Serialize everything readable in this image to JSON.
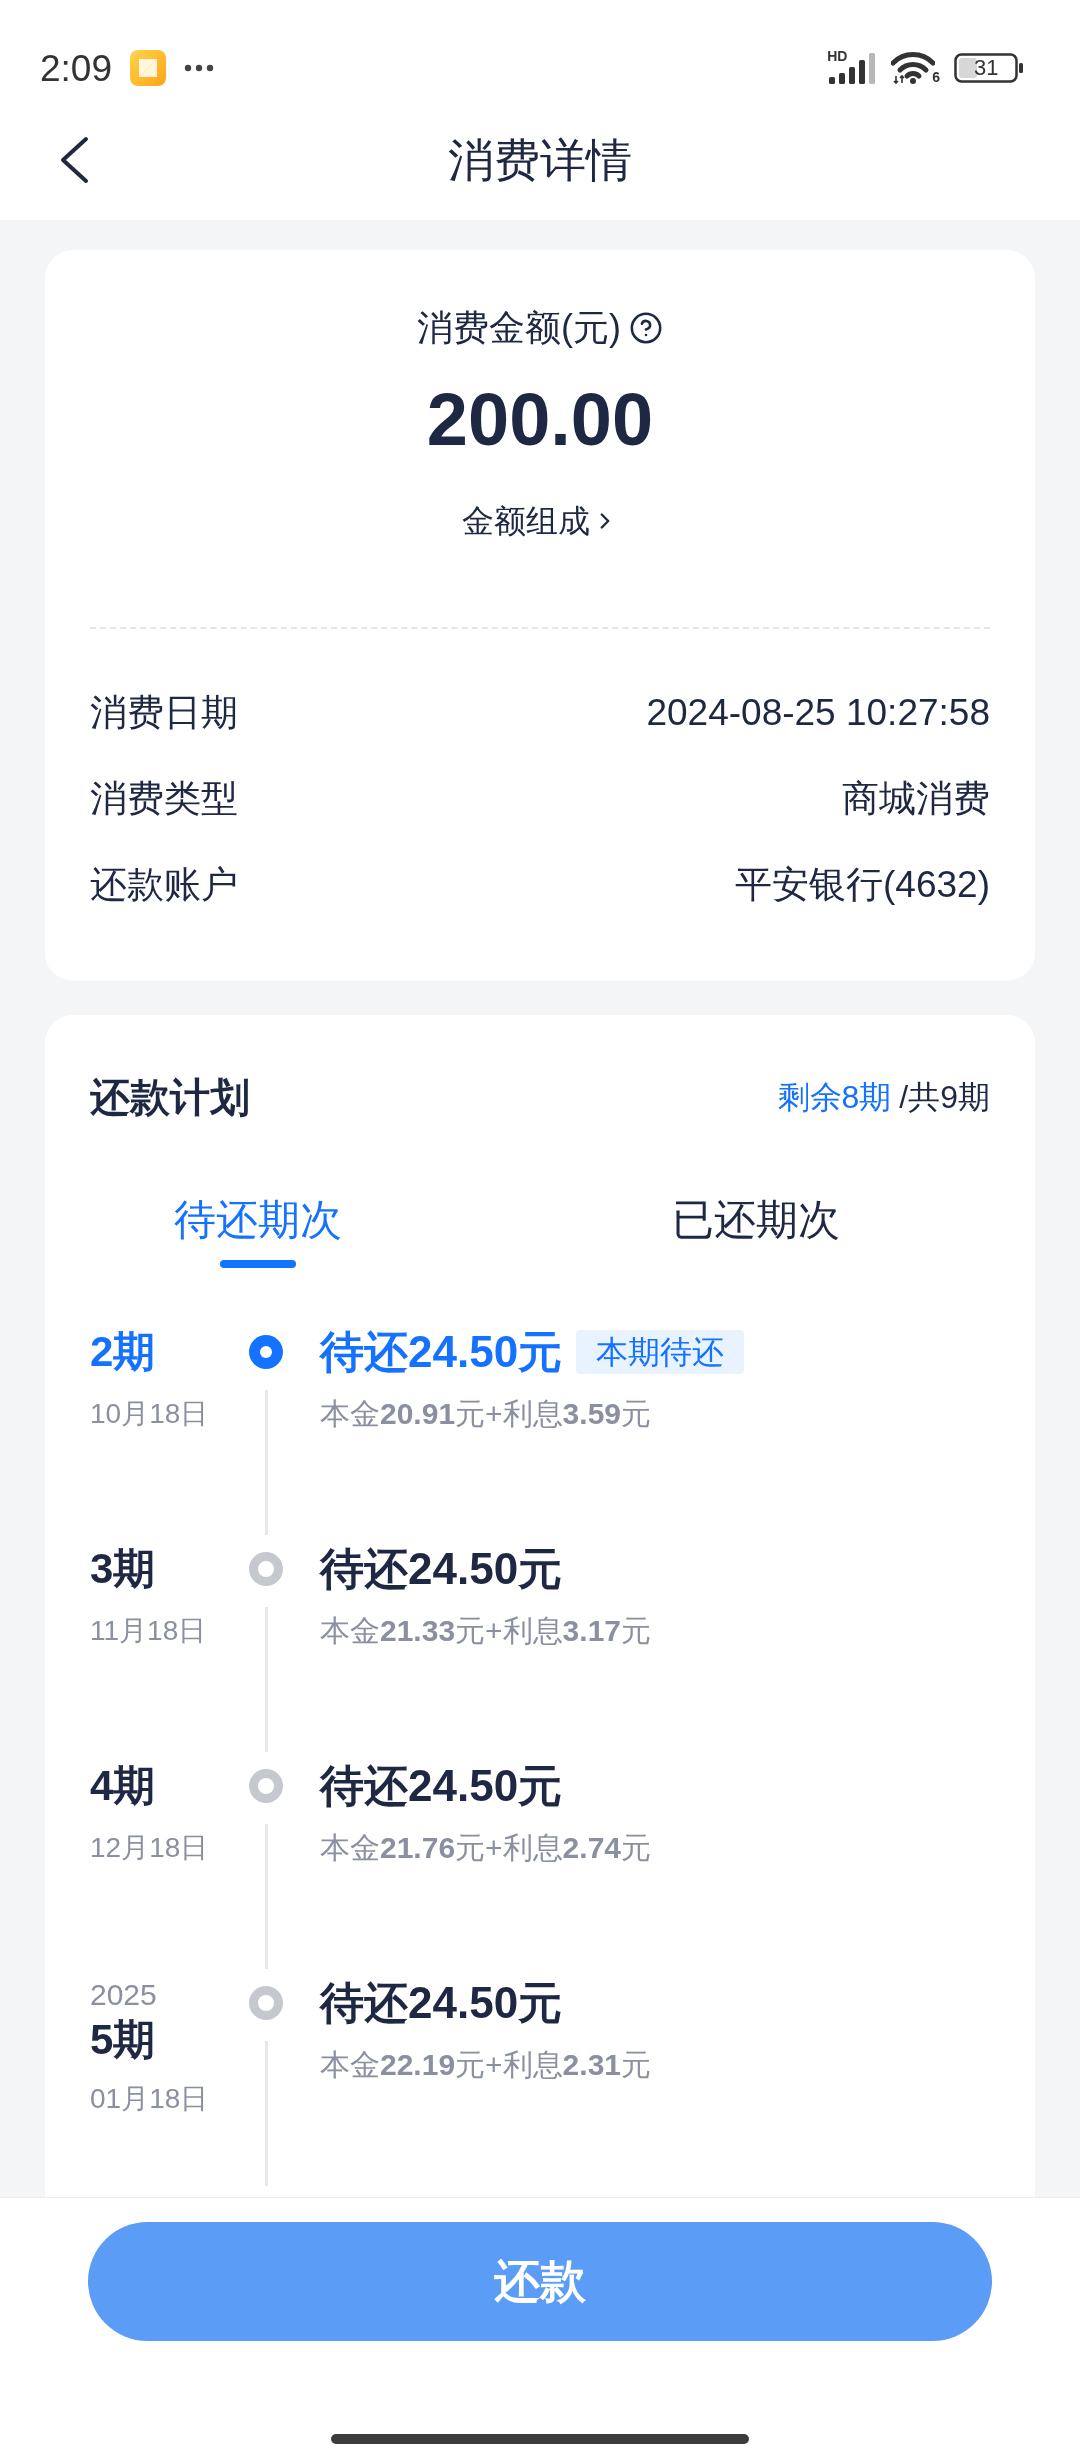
{
  "status_bar": {
    "time": "2:09",
    "network_type": "HD",
    "wifi_standard": "6",
    "battery": "31"
  },
  "header": {
    "title": "消费详情"
  },
  "summary": {
    "amount_label": "消费金额(元)",
    "amount": "200.00",
    "breakdown_link": "金额组成",
    "details": [
      {
        "label": "消费日期",
        "value": "2024-08-25 10:27:58"
      },
      {
        "label": "消费类型",
        "value": "商城消费"
      },
      {
        "label": "还款账户",
        "value": "平安银行(4632)"
      }
    ]
  },
  "plan": {
    "title": "还款计划",
    "remaining": "剩余8期",
    "total": "/共9期",
    "tabs": [
      {
        "label": "待还期次",
        "selected": true
      },
      {
        "label": "已还期次",
        "selected": false
      }
    ],
    "installments": [
      {
        "period": "2期",
        "date": "10月18日",
        "amount": "待还24.50元",
        "badge": "本期待还",
        "breakdown": "本金**20.91**元+利息**3.59**元",
        "current": true
      },
      {
        "period": "3期",
        "date": "11月18日",
        "amount": "待还24.50元",
        "breakdown": "本金**21.33**元+利息**3.17**元",
        "current": false
      },
      {
        "period": "4期",
        "date": "12月18日",
        "amount": "待还24.50元",
        "breakdown": "本金**21.76**元+利息**2.74**元",
        "current": false
      },
      {
        "year": "2025",
        "period": "5期",
        "date": "01月18日",
        "amount": "待还24.50元",
        "breakdown": "本金**22.19**元+利息**2.31**元",
        "current": false
      }
    ]
  },
  "pay_button": {
    "label": "还款",
    "disabled": true
  }
}
